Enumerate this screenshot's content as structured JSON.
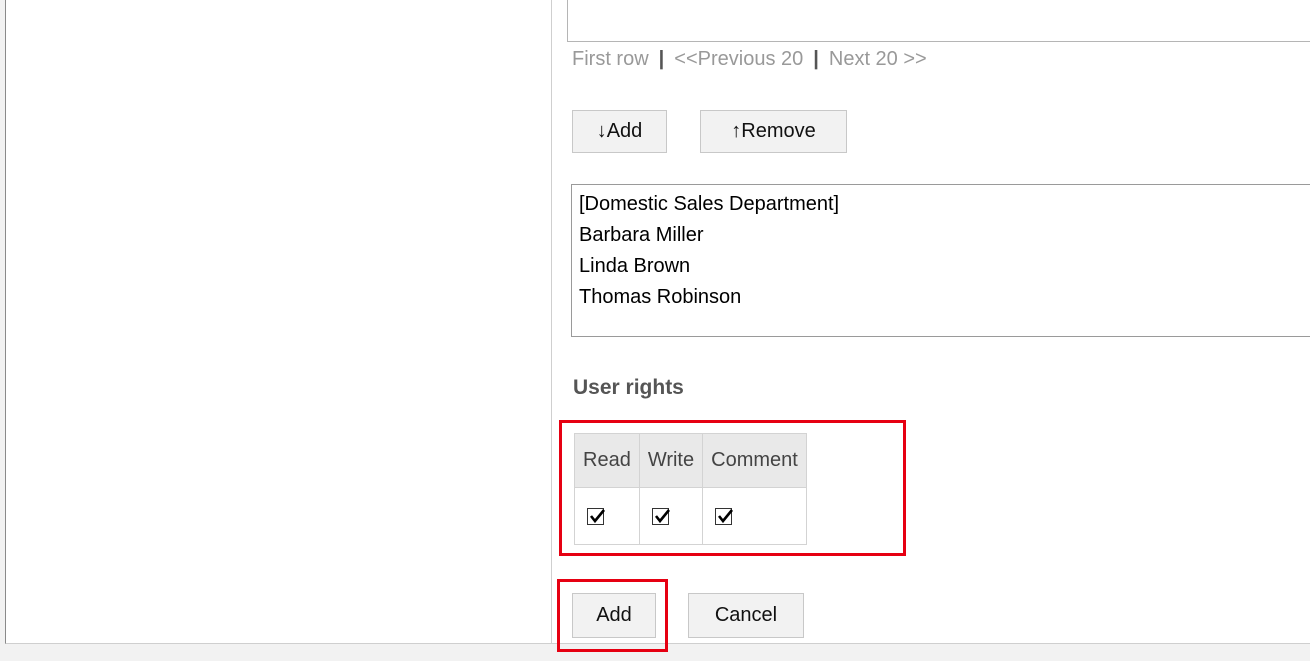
{
  "pager": {
    "first": "First row",
    "previous": "<<Previous 20",
    "next": "Next 20 >>",
    "separator": "|"
  },
  "member_buttons": {
    "add": "↓Add",
    "remove": "↑Remove"
  },
  "member_list": {
    "items": [
      "[Domestic Sales Department]",
      "Barbara Miller",
      "Linda Brown",
      "Thomas Robinson"
    ]
  },
  "user_rights": {
    "title": "User rights",
    "columns": [
      "Read",
      "Write",
      "Comment"
    ],
    "checked": [
      true,
      true,
      true
    ]
  },
  "actions": {
    "add": "Add",
    "cancel": "Cancel"
  },
  "colors": {
    "highlight": "#e60012",
    "link_disabled": "#999999",
    "button_bg": "#f2f2f2"
  }
}
